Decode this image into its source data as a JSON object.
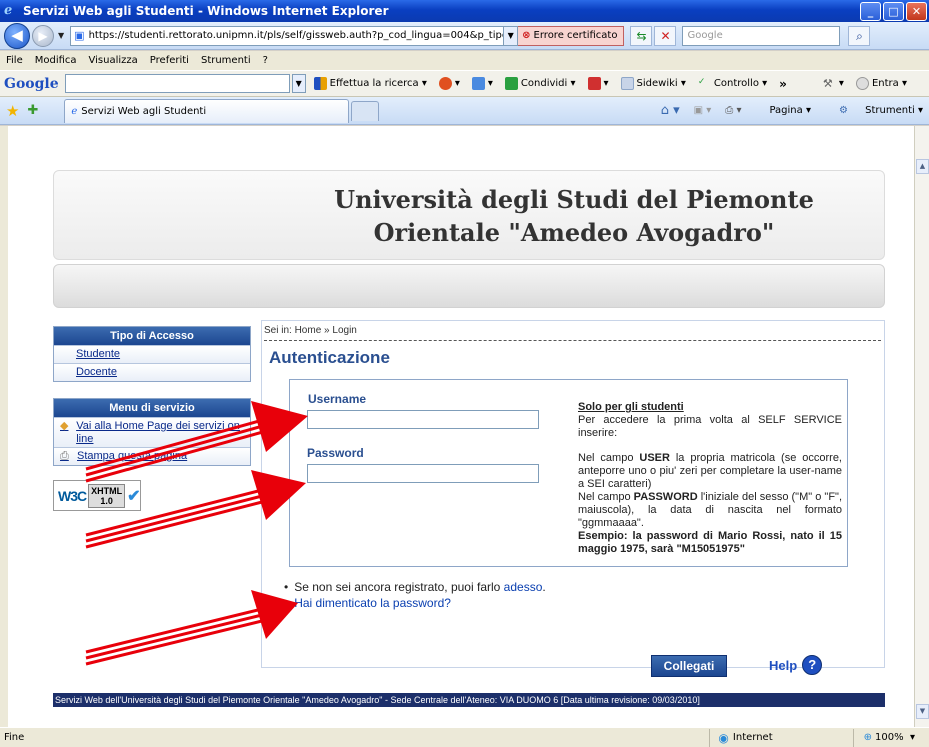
{
  "window": {
    "title": "Servizi Web agli Studenti - Windows Internet Explorer",
    "btn_min": "_",
    "btn_max": "□",
    "btn_close": "✕"
  },
  "address": {
    "url": "https://studenti.rettorato.unipmn.it/pls/self/gissweb.auth?p_cod_lingua=004&p_tipo",
    "cert_error": "Errore certificato",
    "search_placeholder": "Google"
  },
  "menu": [
    "File",
    "Modifica",
    "Visualizza",
    "Preferiti",
    "Strumenti",
    "?"
  ],
  "google_toolbar": {
    "logo": "Google",
    "search": "Effettua la ricerca",
    "share": "Condividi",
    "sidewiki": "Sidewiki",
    "controllo": "Controllo",
    "more": "»",
    "entra": "Entra"
  },
  "tabs": {
    "active": "Servizi Web agli Studenti",
    "pagina": "Pagina",
    "strumenti": "Strumenti"
  },
  "page": {
    "header_title": "Università degli Studi del Piemonte Orientale \"Amedeo Avogadro\"",
    "tipo_accesso": {
      "title": "Tipo di Accesso",
      "items": [
        "Studente",
        "Docente"
      ]
    },
    "menu_servizio": {
      "title": "Menu di servizio",
      "items": [
        "Vai alla Home Page dei servizi on line",
        "Stampa questa pagina"
      ]
    },
    "w3c": {
      "w3": "W3C",
      "xhtml": "XHTML",
      "ver": "1.0"
    },
    "breadcrumb": {
      "prefix": "Sei in:",
      "home": "Home",
      "sep": "»",
      "current": "Login"
    },
    "heading": "Autenticazione",
    "form": {
      "username_label": "Username",
      "password_label": "Password"
    },
    "info": {
      "heading": "Solo per gli studenti",
      "p1": "Per accedere la prima volta al SELF SERVICE inserire:",
      "p2_pre": "Nel campo ",
      "p2_b": "USER",
      "p2_post": " la propria matricola (se occorre, anteporre uno o piu' zeri per completare la user-name a SEI caratteri)",
      "p3_pre": "Nel campo ",
      "p3_b": "PASSWORD",
      "p3_post": " l'iniziale del sesso (\"M\" o \"F\", maiuscola), la data di nascita nel formato \"ggmmaaaa\".",
      "example": "Esempio: la password di Mario Rossi, nato il 15 maggio 1975, sarà \"M15051975\""
    },
    "register_text": "Se non sei ancora registrato, puoi farlo ",
    "register_link": "adesso",
    "register_end": ".",
    "forgot_link": "Hai dimenticato la password?",
    "login_button": "Collegati",
    "help_label": "Help",
    "help_icon": "?",
    "footer": "Servizi Web dell'Università degli Studi del Piemonte Orientale \"Amedeo Avogadro\" - Sede Centrale dell'Ateneo: VIA DUOMO 6 [Data ultima revisione: 09/03/2010]"
  },
  "status": {
    "text": "Fine",
    "zone": "Internet",
    "zoom": "100%"
  },
  "colors": {
    "accent": "#1c4690",
    "arrow": "#e8000a",
    "footer": "#1c2f6a"
  }
}
